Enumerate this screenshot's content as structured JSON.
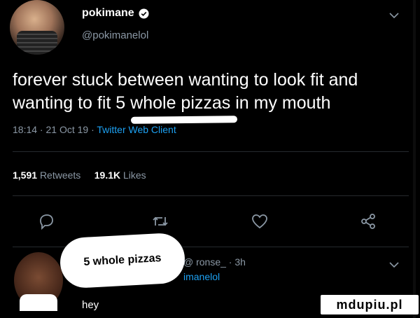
{
  "header": {
    "display_name": "pokimane",
    "handle": "@pokimanelol"
  },
  "tweet": {
    "text": "forever stuck between wanting to look fit and wanting to fit 5 whole pizzas in my mouth",
    "timestamp": "18:14 · 21 Oct 19 · ",
    "source": "Twitter Web Client"
  },
  "stats": {
    "retweets_count": "1,591",
    "retweets_label": "Retweets",
    "likes_count": "19.1K",
    "likes_label": "Likes"
  },
  "actions": {
    "icons": [
      "reply-icon",
      "retweet-icon",
      "like-icon",
      "share-icon"
    ]
  },
  "reply": {
    "bubble_text": "5 whole pizzas",
    "head": "@ ronse_ · 3h",
    "to": "Replying to @pokimanelol",
    "to_visible": "imanelol",
    "text": "hey"
  },
  "watermark": "mdupiu.pl",
  "colors": {
    "background": "#000000",
    "muted": "#8b98a5",
    "accent": "#1da1f2"
  }
}
